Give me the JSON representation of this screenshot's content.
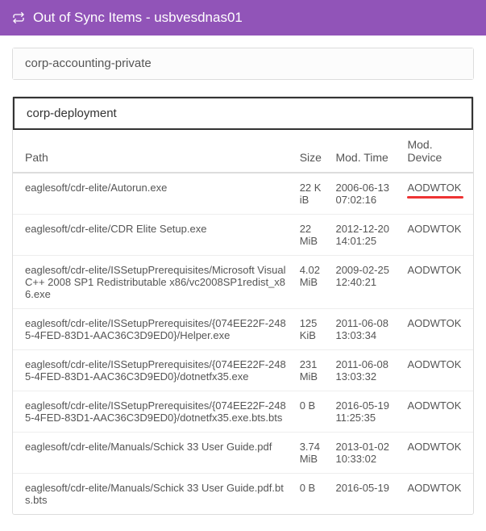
{
  "header": {
    "title": "Out of Sync Items - usbvesdnas01"
  },
  "panels": {
    "collapsed": {
      "title": "corp-accounting-private"
    },
    "expanded": {
      "title": "corp-deployment"
    }
  },
  "columns": {
    "path": "Path",
    "size": "Size",
    "time": "Mod. Time",
    "device": "Mod. Device"
  },
  "rows": [
    {
      "path": "eaglesoft/cdr-elite/Autorun.exe",
      "size": "22 KiB",
      "time": "2006-06-13 07:02:16",
      "device": "AODWTOK",
      "highlight": true
    },
    {
      "path": "eaglesoft/cdr-elite/CDR Elite Setup.exe",
      "size": "22 MiB",
      "time": "2012-12-20 14:01:25",
      "device": "AODWTOK"
    },
    {
      "path": "eaglesoft/cdr-elite/ISSetupPrerequisites/Microsoft Visual C++ 2008 SP1 Redistributable x86/vc2008SP1redist_x86.exe",
      "size": "4.02 MiB",
      "time": "2009-02-25 12:40:21",
      "device": "AODWTOK"
    },
    {
      "path": "eaglesoft/cdr-elite/ISSetupPrerequisites/{074EE22F-2485-4FED-83D1-AAC36C3D9ED0}/Helper.exe",
      "size": "125 KiB",
      "time": "2011-06-08 13:03:34",
      "device": "AODWTOK"
    },
    {
      "path": "eaglesoft/cdr-elite/ISSetupPrerequisites/{074EE22F-2485-4FED-83D1-AAC36C3D9ED0}/dotnetfx35.exe",
      "size": "231 MiB",
      "time": "2011-06-08 13:03:32",
      "device": "AODWTOK"
    },
    {
      "path": "eaglesoft/cdr-elite/ISSetupPrerequisites/{074EE22F-2485-4FED-83D1-AAC36C3D9ED0}/dotnetfx35.exe.bts.bts",
      "size": "0 B",
      "time": "2016-05-19 11:25:35",
      "device": "AODWTOK"
    },
    {
      "path": "eaglesoft/cdr-elite/Manuals/Schick 33 User Guide.pdf",
      "size": "3.74 MiB",
      "time": "2013-01-02 10:33:02",
      "device": "AODWTOK"
    },
    {
      "path": "eaglesoft/cdr-elite/Manuals/Schick 33 User Guide.pdf.bts.bts",
      "size": "0 B",
      "time": "2016-05-19",
      "device": "AODWTOK"
    }
  ]
}
